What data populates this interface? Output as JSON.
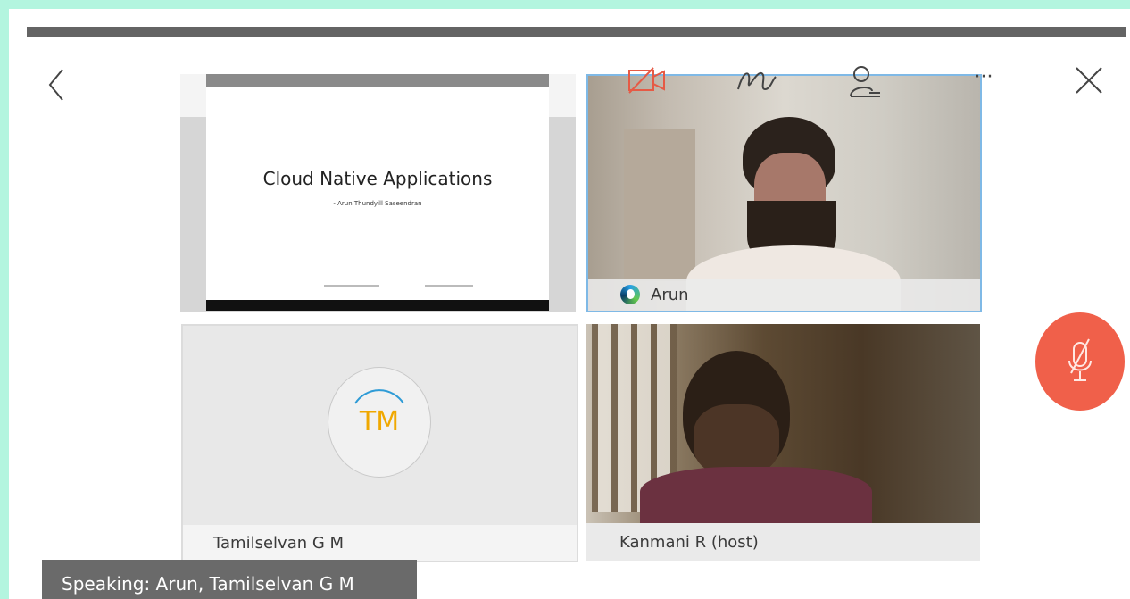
{
  "toolbar": {
    "back_icon": "chevron-left-icon",
    "video_icon": "video-off-icon",
    "annotate_icon": "pen-scribble-icon",
    "participants_icon": "participants-icon",
    "more_label": "···",
    "close_icon": "close-icon"
  },
  "slide": {
    "title": "Cloud Native Applications",
    "subtitle": "- Arun Thundyill Saseendran"
  },
  "tiles": {
    "arun": {
      "name": "Arun",
      "badge_icon": "status-ring-icon"
    },
    "tamil": {
      "name": "Tamilselvan G M",
      "initials": "TM"
    },
    "kanmani": {
      "name": "Kanmani R (host)"
    }
  },
  "status": {
    "speaking": "Speaking: Arun, Tamilselvan G M"
  },
  "mic": {
    "icon": "mic-muted-icon"
  },
  "colors": {
    "accent_red": "#f0604a",
    "active_border": "#7fb9e6",
    "background": "#b3f5df"
  }
}
